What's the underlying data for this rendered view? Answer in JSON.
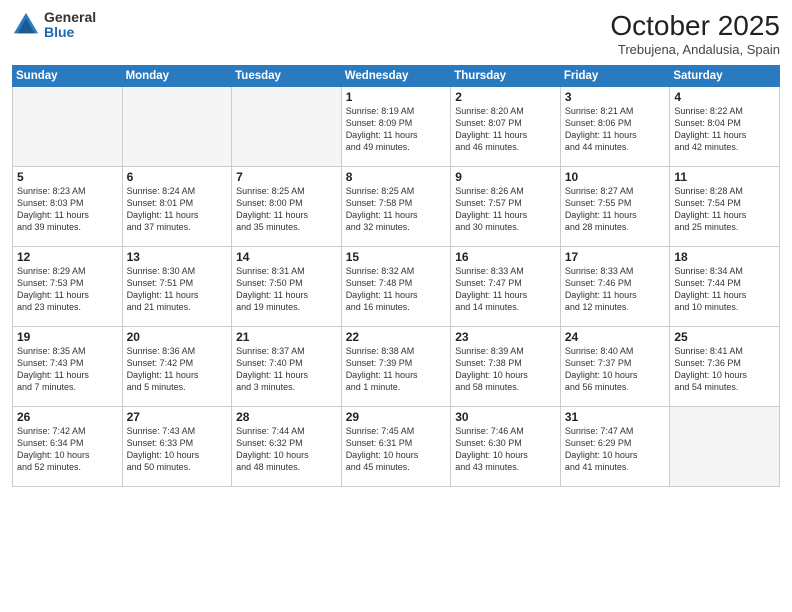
{
  "logo": {
    "general": "General",
    "blue": "Blue"
  },
  "title": "October 2025",
  "location": "Trebujena, Andalusia, Spain",
  "days_header": [
    "Sunday",
    "Monday",
    "Tuesday",
    "Wednesday",
    "Thursday",
    "Friday",
    "Saturday"
  ],
  "weeks": [
    [
      {
        "day": "",
        "info": ""
      },
      {
        "day": "",
        "info": ""
      },
      {
        "day": "",
        "info": ""
      },
      {
        "day": "1",
        "info": "Sunrise: 8:19 AM\nSunset: 8:09 PM\nDaylight: 11 hours\nand 49 minutes."
      },
      {
        "day": "2",
        "info": "Sunrise: 8:20 AM\nSunset: 8:07 PM\nDaylight: 11 hours\nand 46 minutes."
      },
      {
        "day": "3",
        "info": "Sunrise: 8:21 AM\nSunset: 8:06 PM\nDaylight: 11 hours\nand 44 minutes."
      },
      {
        "day": "4",
        "info": "Sunrise: 8:22 AM\nSunset: 8:04 PM\nDaylight: 11 hours\nand 42 minutes."
      }
    ],
    [
      {
        "day": "5",
        "info": "Sunrise: 8:23 AM\nSunset: 8:03 PM\nDaylight: 11 hours\nand 39 minutes."
      },
      {
        "day": "6",
        "info": "Sunrise: 8:24 AM\nSunset: 8:01 PM\nDaylight: 11 hours\nand 37 minutes."
      },
      {
        "day": "7",
        "info": "Sunrise: 8:25 AM\nSunset: 8:00 PM\nDaylight: 11 hours\nand 35 minutes."
      },
      {
        "day": "8",
        "info": "Sunrise: 8:25 AM\nSunset: 7:58 PM\nDaylight: 11 hours\nand 32 minutes."
      },
      {
        "day": "9",
        "info": "Sunrise: 8:26 AM\nSunset: 7:57 PM\nDaylight: 11 hours\nand 30 minutes."
      },
      {
        "day": "10",
        "info": "Sunrise: 8:27 AM\nSunset: 7:55 PM\nDaylight: 11 hours\nand 28 minutes."
      },
      {
        "day": "11",
        "info": "Sunrise: 8:28 AM\nSunset: 7:54 PM\nDaylight: 11 hours\nand 25 minutes."
      }
    ],
    [
      {
        "day": "12",
        "info": "Sunrise: 8:29 AM\nSunset: 7:53 PM\nDaylight: 11 hours\nand 23 minutes."
      },
      {
        "day": "13",
        "info": "Sunrise: 8:30 AM\nSunset: 7:51 PM\nDaylight: 11 hours\nand 21 minutes."
      },
      {
        "day": "14",
        "info": "Sunrise: 8:31 AM\nSunset: 7:50 PM\nDaylight: 11 hours\nand 19 minutes."
      },
      {
        "day": "15",
        "info": "Sunrise: 8:32 AM\nSunset: 7:48 PM\nDaylight: 11 hours\nand 16 minutes."
      },
      {
        "day": "16",
        "info": "Sunrise: 8:33 AM\nSunset: 7:47 PM\nDaylight: 11 hours\nand 14 minutes."
      },
      {
        "day": "17",
        "info": "Sunrise: 8:33 AM\nSunset: 7:46 PM\nDaylight: 11 hours\nand 12 minutes."
      },
      {
        "day": "18",
        "info": "Sunrise: 8:34 AM\nSunset: 7:44 PM\nDaylight: 11 hours\nand 10 minutes."
      }
    ],
    [
      {
        "day": "19",
        "info": "Sunrise: 8:35 AM\nSunset: 7:43 PM\nDaylight: 11 hours\nand 7 minutes."
      },
      {
        "day": "20",
        "info": "Sunrise: 8:36 AM\nSunset: 7:42 PM\nDaylight: 11 hours\nand 5 minutes."
      },
      {
        "day": "21",
        "info": "Sunrise: 8:37 AM\nSunset: 7:40 PM\nDaylight: 11 hours\nand 3 minutes."
      },
      {
        "day": "22",
        "info": "Sunrise: 8:38 AM\nSunset: 7:39 PM\nDaylight: 11 hours\nand 1 minute."
      },
      {
        "day": "23",
        "info": "Sunrise: 8:39 AM\nSunset: 7:38 PM\nDaylight: 10 hours\nand 58 minutes."
      },
      {
        "day": "24",
        "info": "Sunrise: 8:40 AM\nSunset: 7:37 PM\nDaylight: 10 hours\nand 56 minutes."
      },
      {
        "day": "25",
        "info": "Sunrise: 8:41 AM\nSunset: 7:36 PM\nDaylight: 10 hours\nand 54 minutes."
      }
    ],
    [
      {
        "day": "26",
        "info": "Sunrise: 7:42 AM\nSunset: 6:34 PM\nDaylight: 10 hours\nand 52 minutes."
      },
      {
        "day": "27",
        "info": "Sunrise: 7:43 AM\nSunset: 6:33 PM\nDaylight: 10 hours\nand 50 minutes."
      },
      {
        "day": "28",
        "info": "Sunrise: 7:44 AM\nSunset: 6:32 PM\nDaylight: 10 hours\nand 48 minutes."
      },
      {
        "day": "29",
        "info": "Sunrise: 7:45 AM\nSunset: 6:31 PM\nDaylight: 10 hours\nand 45 minutes."
      },
      {
        "day": "30",
        "info": "Sunrise: 7:46 AM\nSunset: 6:30 PM\nDaylight: 10 hours\nand 43 minutes."
      },
      {
        "day": "31",
        "info": "Sunrise: 7:47 AM\nSunset: 6:29 PM\nDaylight: 10 hours\nand 41 minutes."
      },
      {
        "day": "",
        "info": ""
      }
    ]
  ]
}
